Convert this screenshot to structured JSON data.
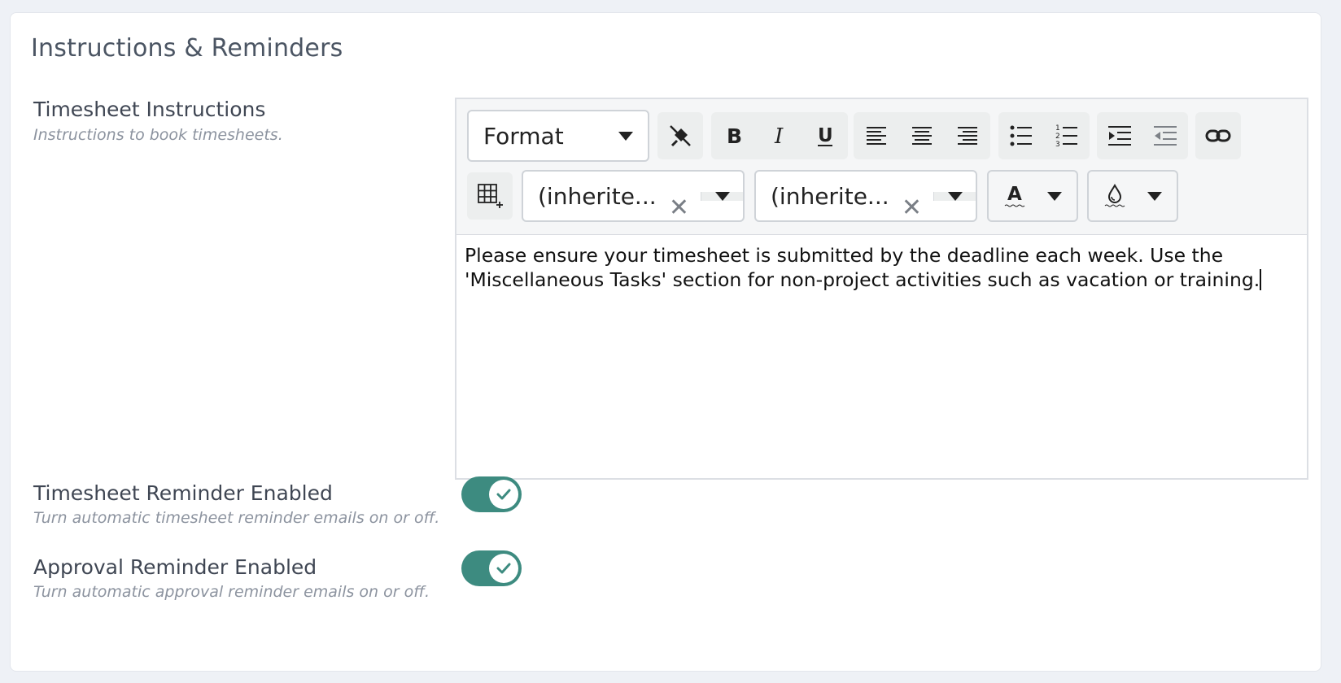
{
  "section": {
    "title": "Instructions & Reminders"
  },
  "instructions": {
    "label": "Timesheet Instructions",
    "help": "Instructions to book timesheets.",
    "editor": {
      "format_label": "Format",
      "font_family_value": "(inherite...",
      "font_size_value": "(inherite...",
      "text_color_glyph": "A",
      "content": "Please ensure your timesheet is submitted by the deadline each week. Use the 'Miscellaneous Tasks' section for non-project activities such as vacation or training."
    }
  },
  "timesheet_reminder": {
    "label": "Timesheet Reminder Enabled",
    "help": "Turn automatic timesheet reminder emails on or off.",
    "enabled": true
  },
  "approval_reminder": {
    "label": "Approval Reminder Enabled",
    "help": "Turn automatic approval reminder emails on or off.",
    "enabled": true
  },
  "colors": {
    "toggle_on": "#3d8b80",
    "background": "#eef1f6"
  },
  "icons": [
    "clear-format-icon",
    "bold-icon",
    "italic-icon",
    "underline-icon",
    "align-left-icon",
    "align-center-icon",
    "align-right-icon",
    "bullet-list-icon",
    "numbered-list-icon",
    "indent-icon",
    "outdent-icon",
    "link-icon",
    "table-icon",
    "text-color-icon",
    "background-color-icon",
    "check-icon"
  ]
}
